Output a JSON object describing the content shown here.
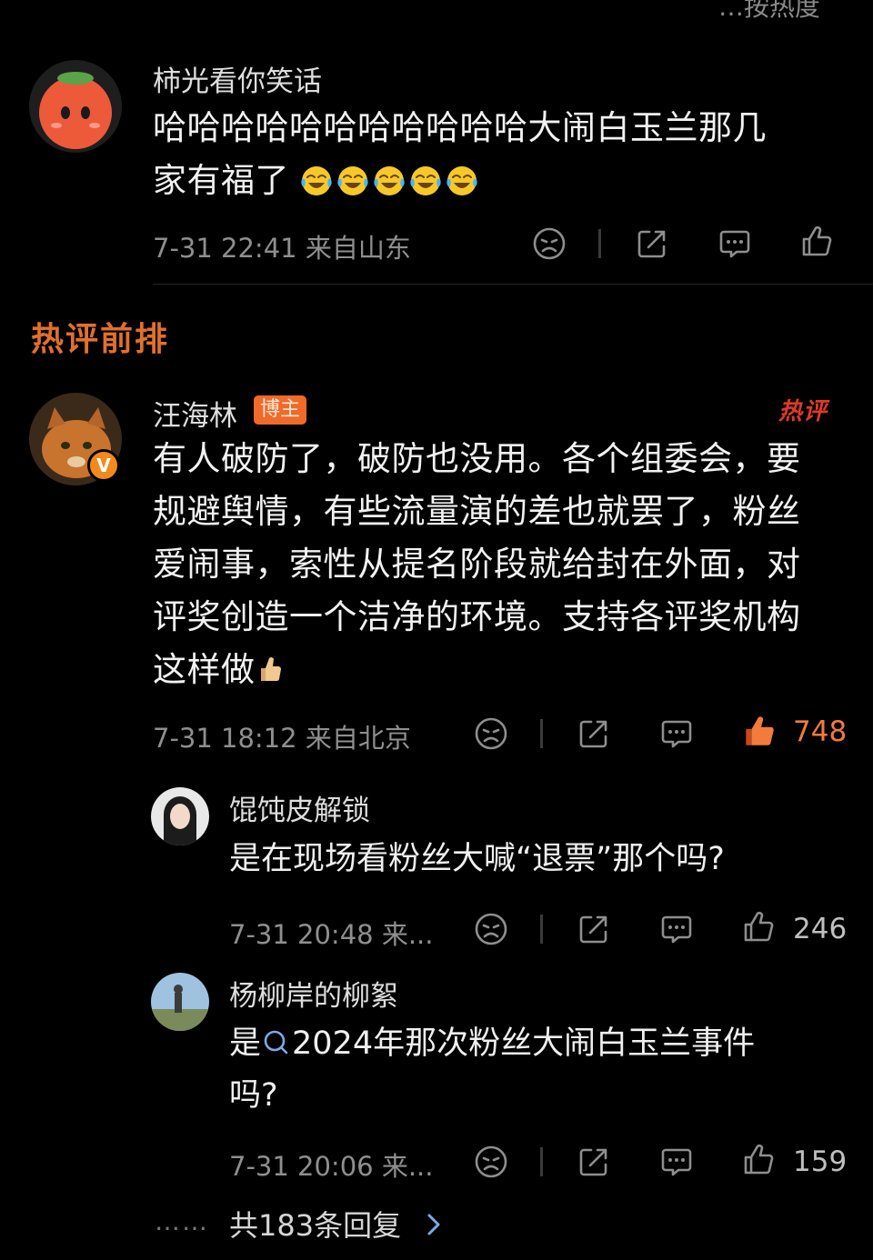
{
  "top_cut_text": "…按热度",
  "comments": [
    {
      "username": "柿光看你笑话",
      "text": "哈哈哈哈哈哈哈哈哈哈哈大闹白玉兰那几",
      "text_line2": "家有福了",
      "emoji": "laughing-crying-emoji",
      "meta": "7-31 22:41 来自山东"
    }
  ],
  "section_title": "热评前排",
  "hot_comment": {
    "username": "汪海林",
    "badge": "博主",
    "hot_tag": "热评",
    "lines": [
      "有人破防了，破防也没用。各个组委会，要",
      "规避舆情，有些流量演的差也就罢了，粉丝",
      "爱闹事，索性从提名阶段就给封在外面，对",
      "评奖创造一个洁净的环境。支持各评奖机构",
      "这样做"
    ],
    "meta": "7-31 18:12 来自北京",
    "likes": "748"
  },
  "replies": [
    {
      "username": "馄饨皮解锁",
      "text": "是在现场看粉丝大喊“退票”那个吗?",
      "meta": "7-31 20:48 来...",
      "likes": "246"
    },
    {
      "username": "杨柳岸的柳絮",
      "text_line1": "2024年那次粉丝大闹白玉兰事件",
      "text_prefix": "是",
      "text_line2": "吗?",
      "meta": "7-31 20:06 来...",
      "likes": "159"
    }
  ],
  "more_replies": {
    "dots": "……",
    "label": "共183条回复"
  },
  "colors": {
    "accent_orange": "#f06a2a",
    "section_orange": "#e0702e",
    "link_blue": "#7fa8e6"
  }
}
